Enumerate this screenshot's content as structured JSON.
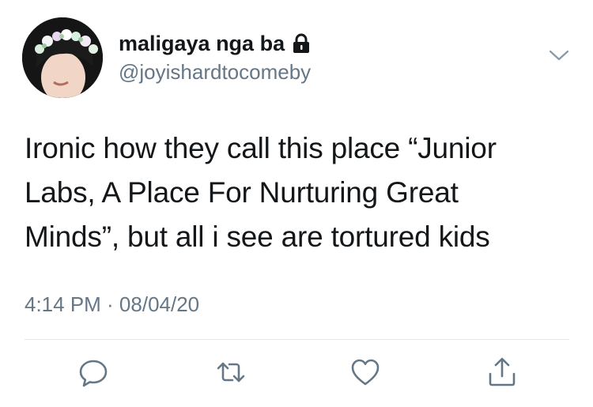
{
  "tweet": {
    "display_name": "maligaya nga ba",
    "handle": "@joyishardtocomeby",
    "text_lines": [
      "Ironic how they call this place “Junior",
      "Labs, A Place For Nurturing Great",
      "Minds”, but all i see are tortured kids"
    ],
    "timestamp": "4:14 PM · 08/04/20"
  },
  "icons": {
    "lock": "lock-icon",
    "menu": "chevron-down-icon",
    "reply": "reply-icon",
    "retweet": "retweet-icon",
    "like": "heart-icon",
    "share": "share-icon"
  },
  "colors": {
    "text": "#14171a",
    "secondary": "#657786",
    "divider": "#e1e8ed"
  }
}
